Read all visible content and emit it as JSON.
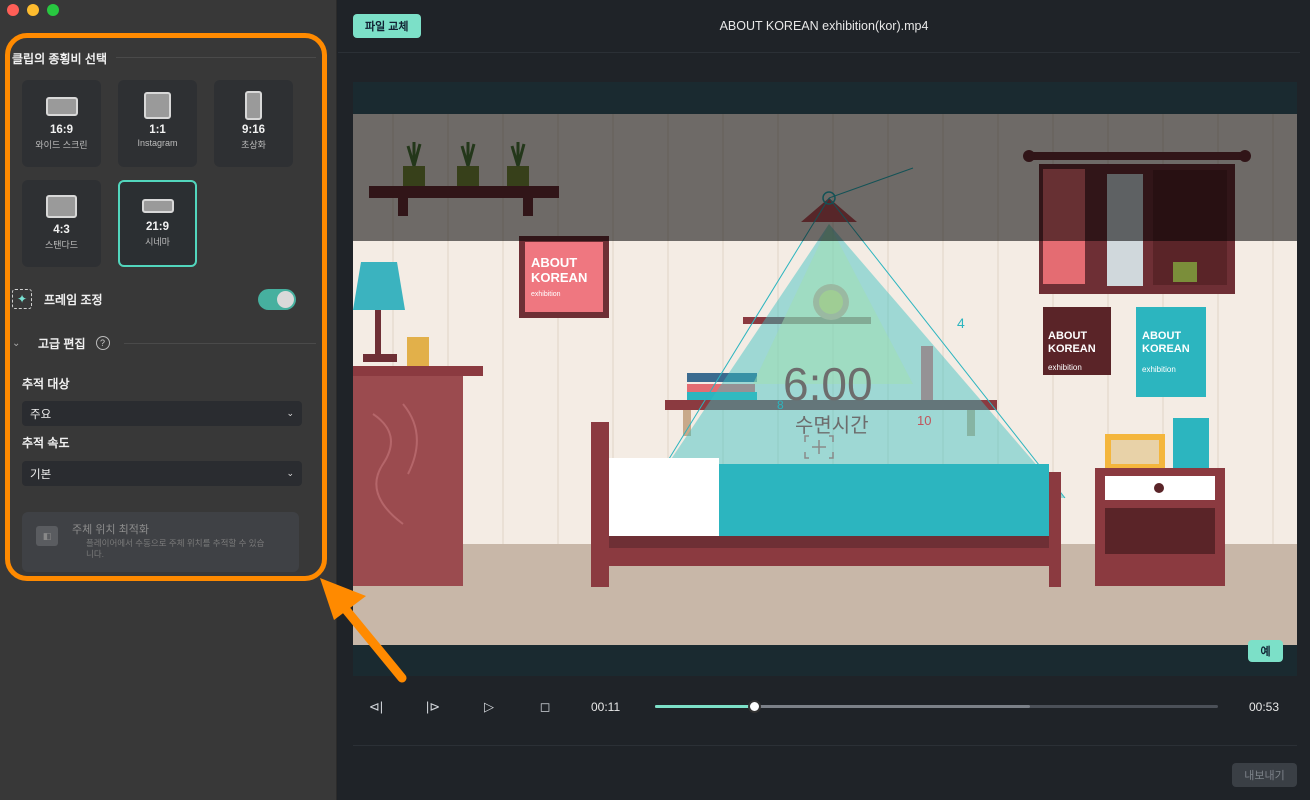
{
  "sidebar": {
    "section_title": "클립의 종횡비 선택",
    "ratios": [
      {
        "main": "16:9",
        "sub": "와이드 스크린",
        "selected": false
      },
      {
        "main": "1:1",
        "sub": "Instagram",
        "selected": false
      },
      {
        "main": "9:16",
        "sub": "초상화",
        "selected": false
      },
      {
        "main": "4:3",
        "sub": "스탠다드",
        "selected": false
      },
      {
        "main": "21:9",
        "sub": "시네마",
        "selected": true
      }
    ],
    "frame_adjust_label": "프레임 조정",
    "frame_adjust_on": true,
    "advanced_label": "고급 편집",
    "help_glyph": "?",
    "tracking_target_label": "추적 대상",
    "tracking_target_value": "주요",
    "tracking_speed_label": "추적 속도",
    "tracking_speed_value": "기본",
    "optimize_title": "주체 위치 최적화",
    "optimize_desc": "플레이어에서 수동으로 주체 위치를 추적할 수 있습니다."
  },
  "header": {
    "replace_button": "파일 교체",
    "file_title": "ABOUT KOREAN exhibition(kor).mp4"
  },
  "video": {
    "sign_left": [
      "ABOUT",
      "KOREAN",
      "exhibition"
    ],
    "sign_right1": [
      "ABOUT",
      "KOREAN",
      "exhibition"
    ],
    "sign_right2": [
      "ABOUT",
      "KOREAN",
      "exhibition"
    ],
    "clock_text": "6:00",
    "caption": "수면시간",
    "num_4": "4",
    "num_10": "10",
    "num_8": "8",
    "yes_button": "예"
  },
  "player": {
    "current_time": "00:11",
    "total_time": "00:53",
    "progress": 0.175,
    "buffered": 0.666
  },
  "footer": {
    "export_button": "내보내기"
  },
  "colors": {
    "accent": "#7ce0c8",
    "highlight": "#ff8a00"
  }
}
